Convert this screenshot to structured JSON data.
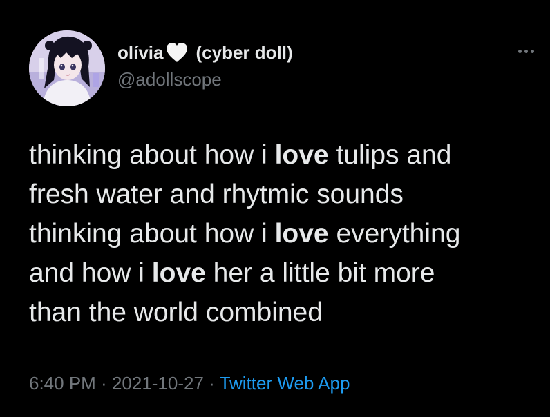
{
  "author": {
    "display_name": "olívia",
    "display_name_suffix": "(cyber doll)",
    "handle": "@adollscope",
    "heart_icon": "white-heart-icon",
    "avatar_icon": "anime-avatar"
  },
  "menu": {
    "icon": "more-options-icon"
  },
  "tweet": {
    "lines": [
      [
        "thinking about how i ",
        "love",
        " tulips and"
      ],
      [
        "fresh water and rhytmic sounds",
        "",
        ""
      ],
      [
        "thinking about how i ",
        "love",
        " everything"
      ],
      [
        "and how i ",
        "love",
        " her a little bit more"
      ],
      [
        "than the world combined",
        "",
        ""
      ]
    ]
  },
  "meta": {
    "time": "6:40 PM",
    "separator1": " · ",
    "date": "2021-10-27",
    "separator2": " · ",
    "source": "Twitter Web App"
  },
  "colors": {
    "background": "#000000",
    "text": "#e7e9ea",
    "muted": "#71767b",
    "link": "#1d9bf0"
  }
}
